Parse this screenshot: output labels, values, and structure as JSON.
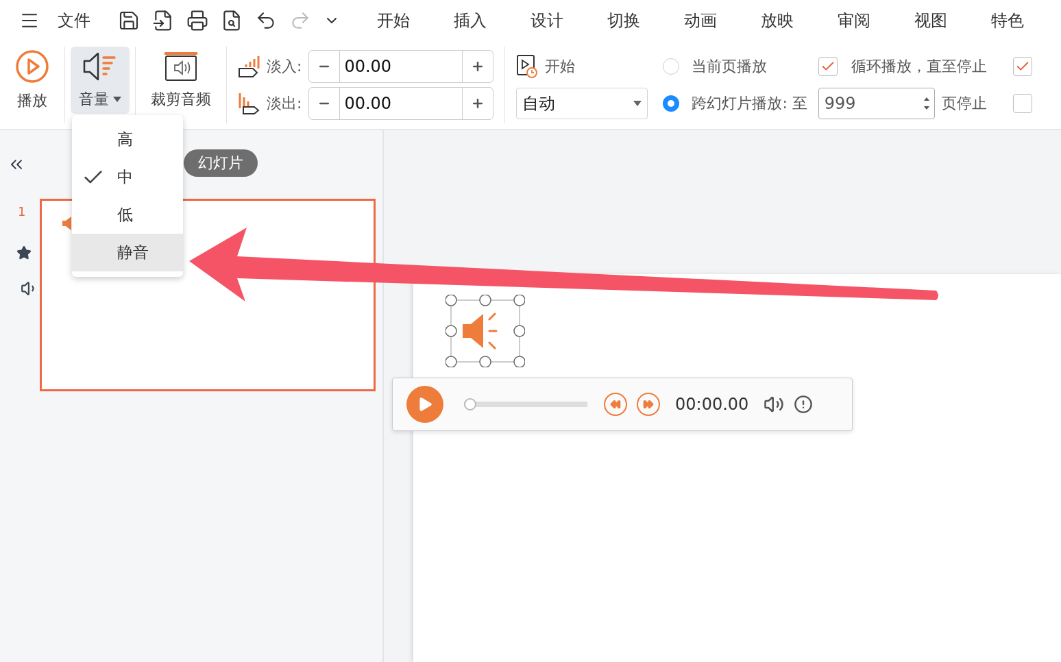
{
  "menu_bar": {
    "file": "文件",
    "tabs": [
      {
        "label": "开始",
        "selected": false
      },
      {
        "label": "插入",
        "selected": false
      },
      {
        "label": "设计",
        "selected": false
      },
      {
        "label": "切换",
        "selected": false
      },
      {
        "label": "动画",
        "selected": false
      },
      {
        "label": "放映",
        "selected": false
      },
      {
        "label": "审阅",
        "selected": false
      },
      {
        "label": "视图",
        "selected": false
      },
      {
        "label": "特色",
        "selected": false
      }
    ]
  },
  "ribbon": {
    "play": "播放",
    "volume": {
      "label": "音量",
      "expanded": true
    },
    "trim": "裁剪音频",
    "fades": [
      {
        "label": "淡入:",
        "value": "00.00"
      },
      {
        "label": "淡出:",
        "value": "00.00"
      }
    ],
    "start": {
      "label": "开始",
      "value": "自动"
    },
    "play_options": [
      {
        "label": "当前页播放",
        "selected": false
      },
      {
        "label": "跨幻灯片播放: 至",
        "selected": true
      }
    ],
    "stop_page": {
      "value": "999",
      "suffix": "页停止"
    },
    "loop": {
      "label": "循环播放，直至停止",
      "checked": true
    },
    "extra_checks": [
      {
        "checked": true
      },
      {
        "checked": false
      }
    ]
  },
  "volume_menu": [
    {
      "label": "高",
      "checked": false,
      "selected": false
    },
    {
      "label": "中",
      "checked": true,
      "selected": false
    },
    {
      "label": "低",
      "checked": false,
      "selected": false
    },
    {
      "label": "静音",
      "checked": false,
      "selected": true
    }
  ],
  "slides_pane": {
    "tab_label": "幻灯片",
    "slides": [
      {
        "number": "1",
        "selected": true
      }
    ]
  },
  "player": {
    "time": "00:00.00",
    "level": 0
  }
}
